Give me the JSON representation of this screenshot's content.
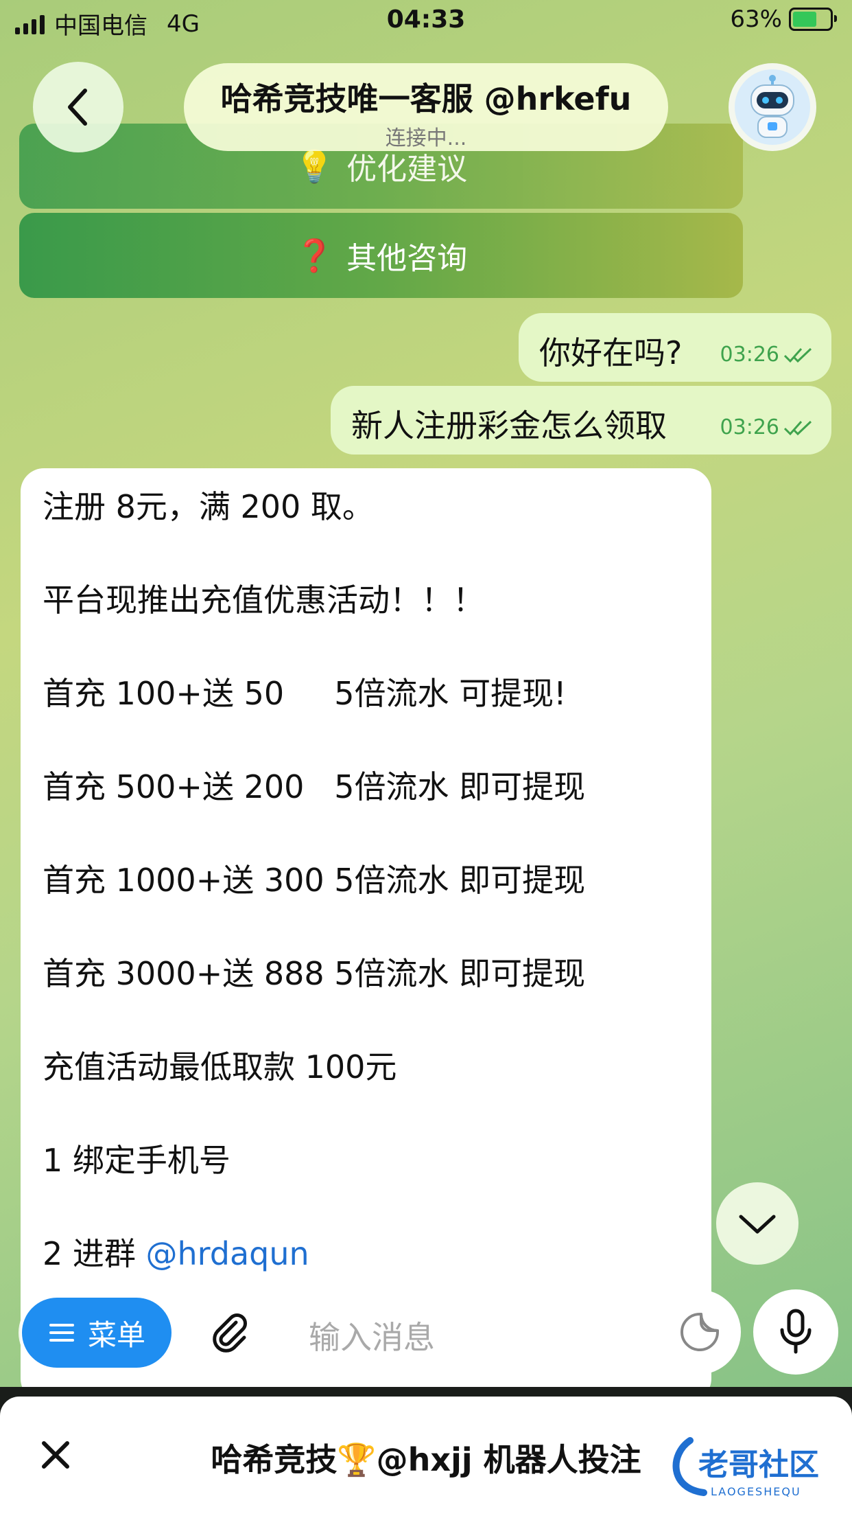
{
  "status_bar": {
    "carrier": "中国电信",
    "network": "4G",
    "time": "04:33",
    "battery": "63%"
  },
  "keyboard_buttons": [
    {
      "icon": "💡",
      "label": "优化建议"
    },
    {
      "icon": "❓",
      "label": "其他咨询"
    }
  ],
  "header": {
    "title": "哈希竞技唯一客服 @hrkefu",
    "subtitle": "连接中..."
  },
  "outgoing_messages": [
    {
      "text": "你好在吗?",
      "time": "03:26"
    },
    {
      "text": "新人注册彩金怎么领取",
      "time": "03:26"
    }
  ],
  "incoming_message": {
    "lines": [
      "注册 8元，满 200 取。",
      "平台现推出充值优惠活动！！！",
      "首充 100+送 50     5倍流水 可提现!",
      "首充 500+送 200   5倍流水 即可提现",
      "首充 1000+送 300 5倍流水 即可提现",
      "首充 3000+送 888 5倍流水 即可提现",
      "充值活动最低取款 100元",
      "1 绑定手机号"
    ],
    "last_line_prefix": "2 进群 ",
    "last_line_mention": "@hrdaqun"
  },
  "composer": {
    "menu_label": "菜单",
    "placeholder": "输入消息"
  },
  "bottom_sheet": {
    "text": "哈希竞技🏆@hxjj 机器人投注"
  },
  "watermark": {
    "main": "老哥社区",
    "sub": "LAOGESHEQU"
  },
  "colors": {
    "accent": "#1f8ef1",
    "outgoing_bubble": "#e4f7c6",
    "check": "#3fa34d",
    "mention": "#1f6fd1"
  }
}
